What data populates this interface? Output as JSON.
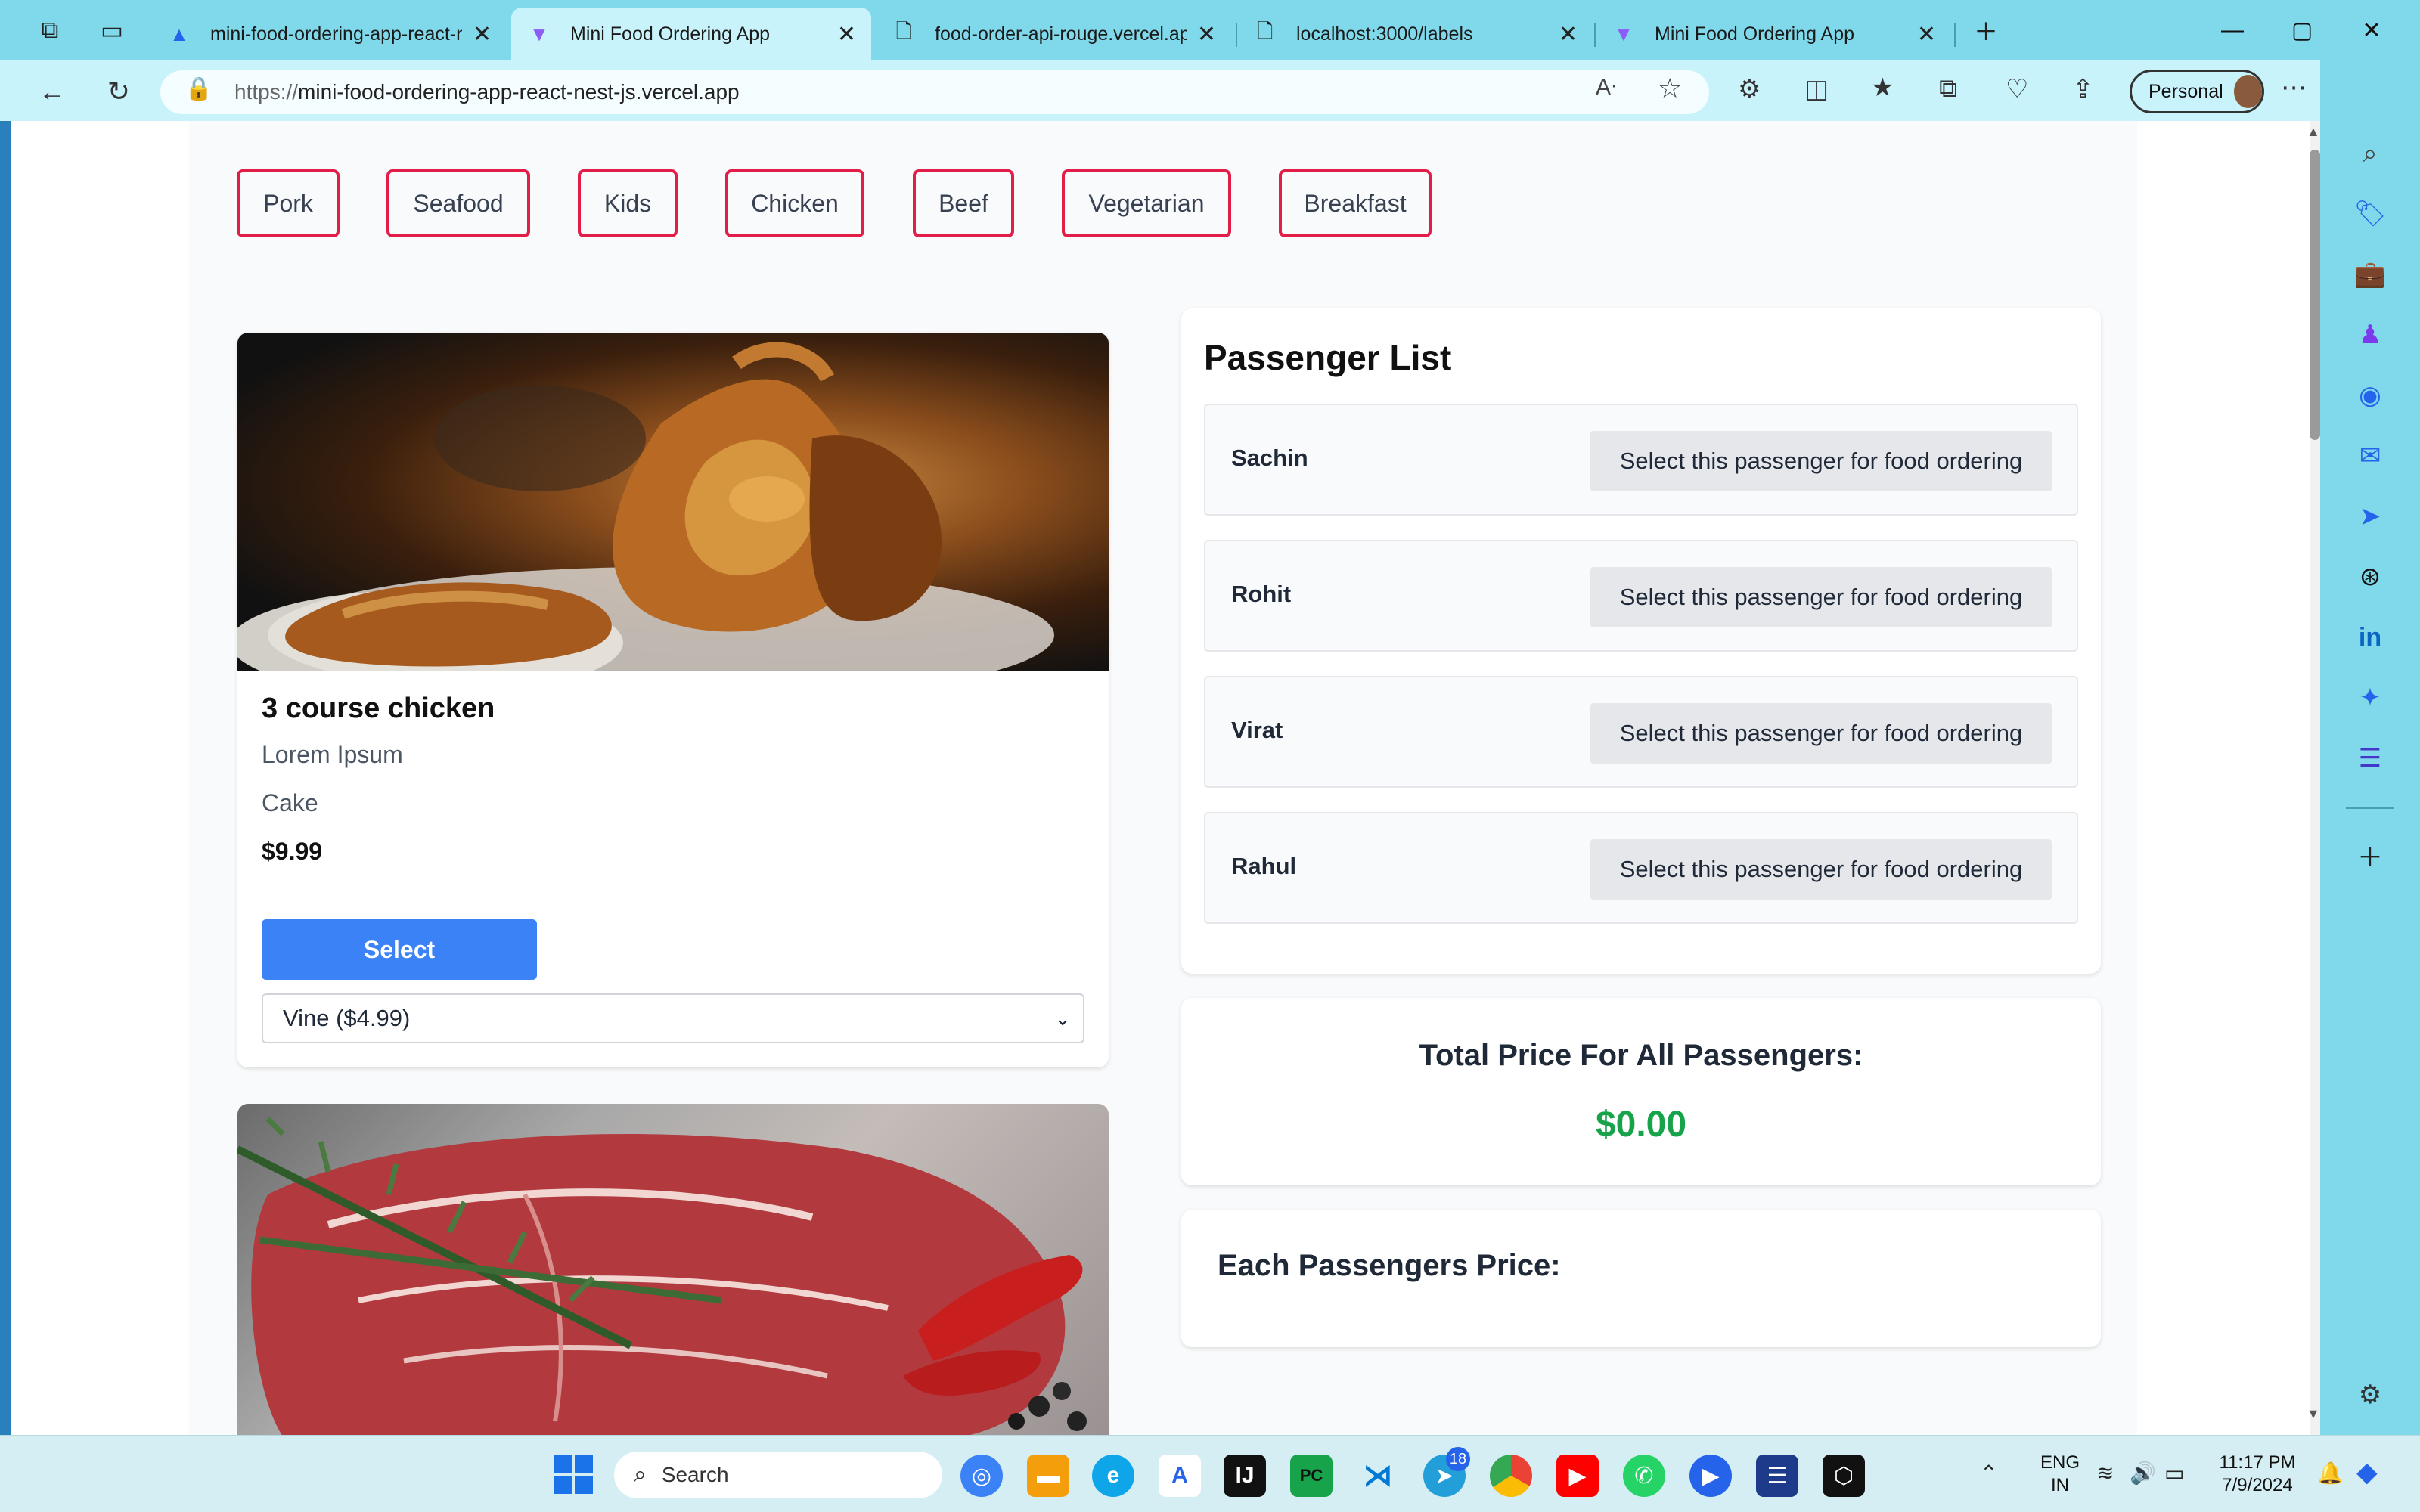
{
  "browser": {
    "tabs": [
      {
        "title": "mini-food-ordering-app-react-n",
        "icon": "vercel-icon",
        "active": false
      },
      {
        "title": "Mini Food Ordering App",
        "icon": "vite-icon",
        "active": true
      },
      {
        "title": "food-order-api-rouge.vercel.app",
        "icon": "page-icon",
        "active": false
      },
      {
        "title": "localhost:3000/labels",
        "icon": "page-icon",
        "active": false
      },
      {
        "title": "Mini Food Ordering App",
        "icon": "vite-icon",
        "active": false
      }
    ],
    "url_protocol": "https://",
    "url_host": "mini-food-ordering-app-react-nest-js.vercel.app",
    "profile_label": "Personal"
  },
  "categories": [
    "Pork",
    "Seafood",
    "Kids",
    "Chicken",
    "Beef",
    "Vegetarian",
    "Breakfast"
  ],
  "food_items": [
    {
      "title": "3 course chicken",
      "description": "Lorem Ipsum",
      "dessert": "Cake",
      "price": "$9.99",
      "select_label": "Select",
      "addon_selected": "Vine ($4.99)"
    }
  ],
  "passenger_list": {
    "title": "Passenger List",
    "select_label": "Select this passenger for food ordering",
    "passengers": [
      "Sachin",
      "Rohit",
      "Virat",
      "Rahul"
    ]
  },
  "totals": {
    "total_label": "Total Price For All Passengers:",
    "total_value": "$0.00",
    "each_label": "Each Passengers Price:"
  },
  "taskbar": {
    "search_label": "Search",
    "telegram_badge": "18",
    "language": "ENG",
    "region": "IN",
    "time": "11:17 PM",
    "date": "7/9/2024"
  },
  "colors": {
    "category_border": "#e11d48",
    "select_button": "#3b82f6",
    "total_value": "#16a34a",
    "browser_chrome": "#7fd9ea"
  }
}
